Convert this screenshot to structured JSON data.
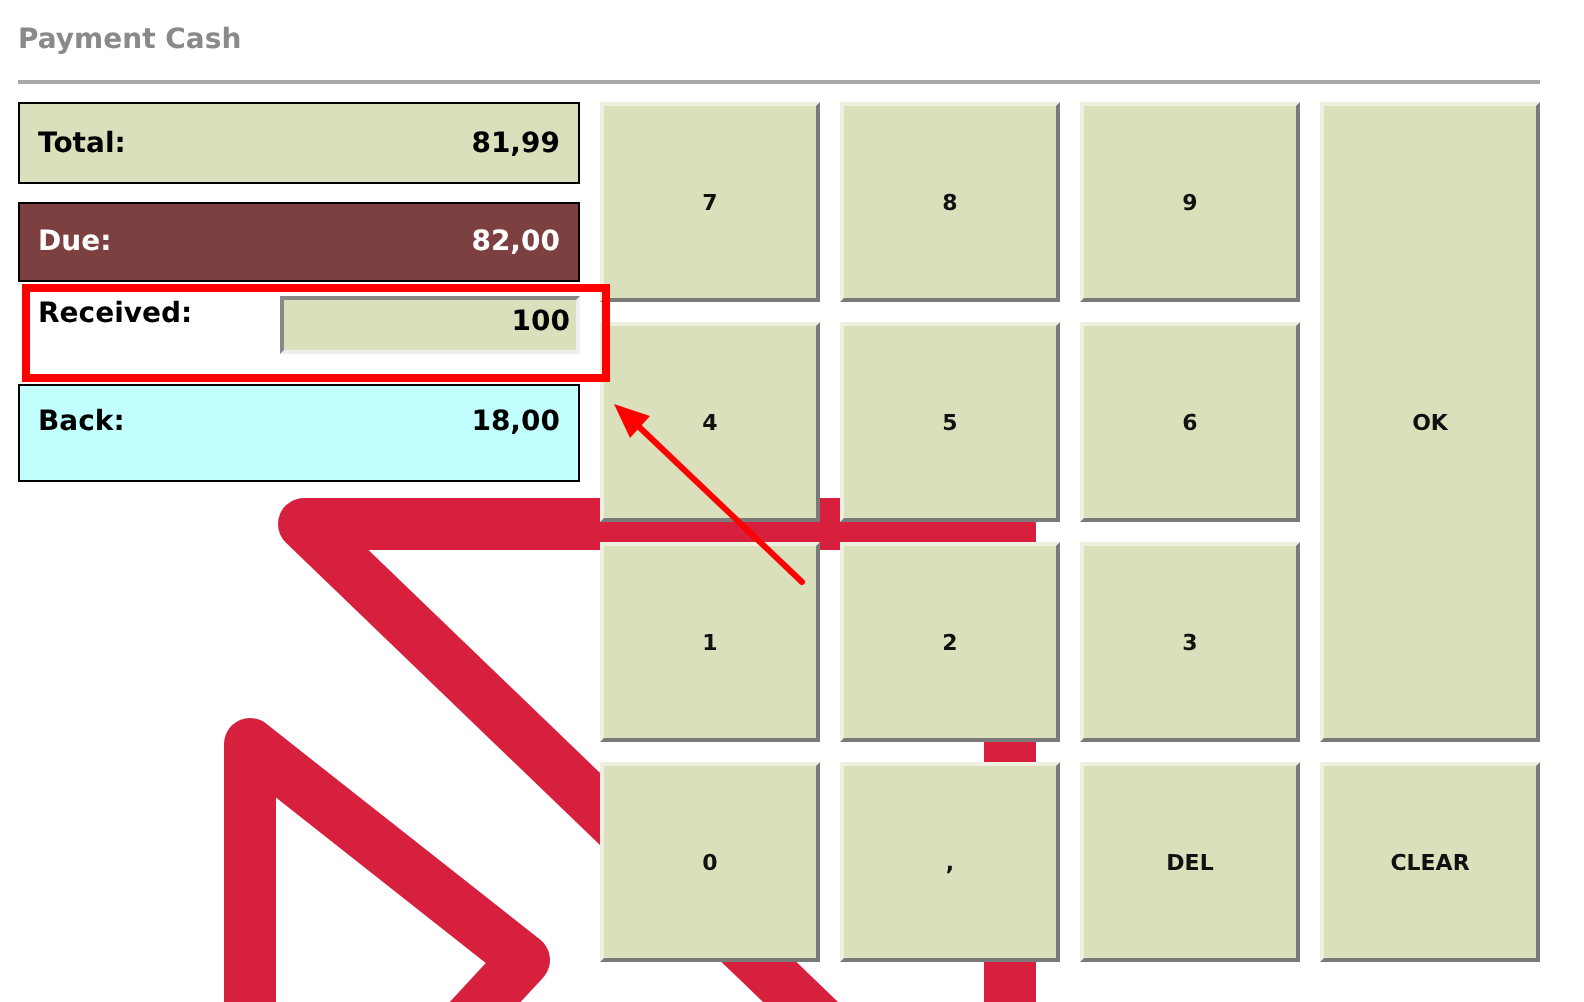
{
  "window": {
    "title": "Payment Cash"
  },
  "summary": [
    {
      "kind": "total",
      "label": "Total:",
      "value": "81,99"
    },
    {
      "kind": "due",
      "label": "Due:",
      "value": "82,00"
    },
    {
      "kind": "received",
      "label": "Received:",
      "value": "100"
    },
    {
      "kind": "back",
      "label": "Back:",
      "value": "18,00"
    }
  ],
  "keypad": [
    {
      "label": "7",
      "kind": "key"
    },
    {
      "label": "8",
      "kind": "key"
    },
    {
      "label": "9",
      "kind": "key"
    },
    {
      "label": "4",
      "kind": "key"
    },
    {
      "label": "5",
      "kind": "key"
    },
    {
      "label": "6",
      "kind": "key"
    },
    {
      "label": "OK",
      "kind": "enter"
    },
    {
      "label": "1",
      "kind": "key"
    },
    {
      "label": "2",
      "kind": "key"
    },
    {
      "label": "3",
      "kind": "key"
    },
    {
      "label": "0",
      "kind": "key"
    },
    {
      "label": ",",
      "kind": "key"
    },
    {
      "label": "DEL",
      "kind": "key"
    },
    {
      "label": "CLEAR",
      "kind": "key"
    }
  ],
  "callout": {
    "highlight_box": true,
    "arrow": true
  }
}
